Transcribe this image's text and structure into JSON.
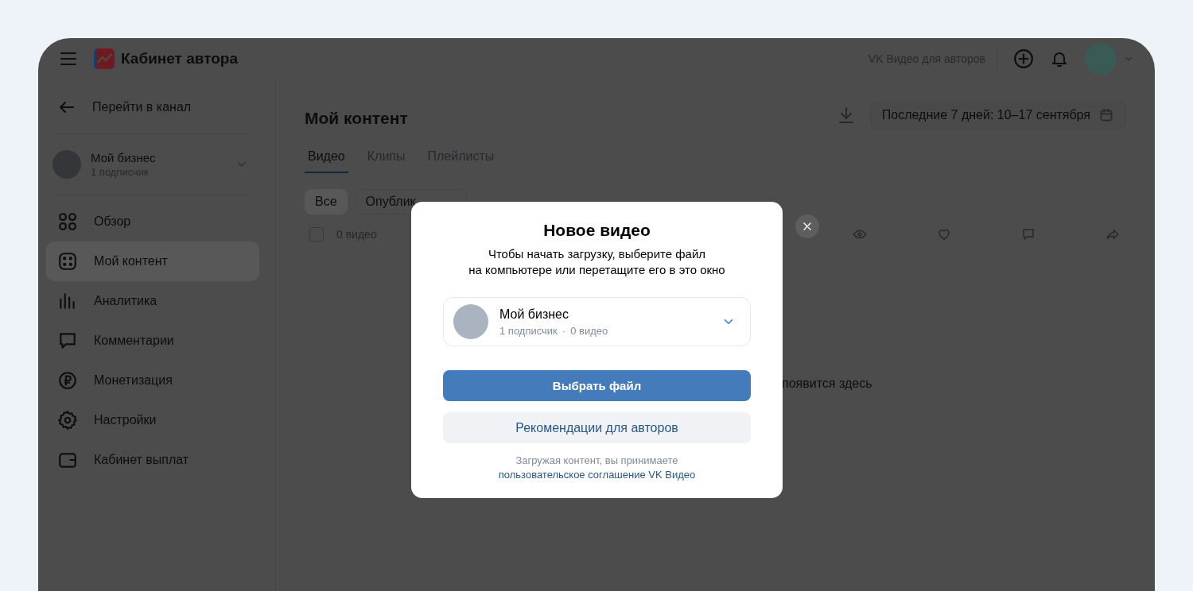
{
  "header": {
    "title": "Кабинет автора",
    "link": "VK Видео для авторов"
  },
  "sidebar": {
    "back": "Перейти в канал",
    "channel": {
      "name": "Мой бизнес",
      "subscribers": "1 подписчик"
    },
    "items": [
      {
        "kind": "overview",
        "label": "Обзор",
        "selected": false
      },
      {
        "kind": "content",
        "label": "Мой контент",
        "selected": true
      },
      {
        "kind": "analytics",
        "label": "Аналитика",
        "selected": false
      },
      {
        "kind": "comments",
        "label": "Комментарии",
        "selected": false
      },
      {
        "kind": "monetization",
        "label": "Монетизация",
        "selected": false
      },
      {
        "kind": "settings",
        "label": "Настройки",
        "selected": false
      },
      {
        "kind": "payouts",
        "label": "Кабинет выплат",
        "selected": false
      }
    ]
  },
  "main": {
    "title": "Мой контент",
    "period": "Последние 7 дней: 10–17 сентября",
    "tabs": [
      {
        "label": "Видео",
        "selected": true
      },
      {
        "label": "Клипы",
        "selected": false
      },
      {
        "label": "Плейлисты",
        "selected": false
      }
    ],
    "filters": [
      {
        "label": "Все",
        "selected": true
      },
      {
        "label": "Опублик",
        "selected": false
      }
    ],
    "select_all": {
      "label": "0 видео",
      "checked": false
    },
    "empty_text": "появится здесь"
  },
  "modal": {
    "title": "Новое видео",
    "description": [
      "Чтобы начать загрузку, выберите файл",
      "на компьютере или перетащите его в это окно"
    ],
    "channel": {
      "name": "Мой бизнес",
      "subscribers": "1 подписчик",
      "separator": "·",
      "videos": "0 видео"
    },
    "primary_button": "Выбрать файл",
    "secondary_button": "Рекомендации для авторов",
    "note": "Загружая контент, вы принимаете",
    "link": "пользовательское соглашение VK Видео"
  }
}
